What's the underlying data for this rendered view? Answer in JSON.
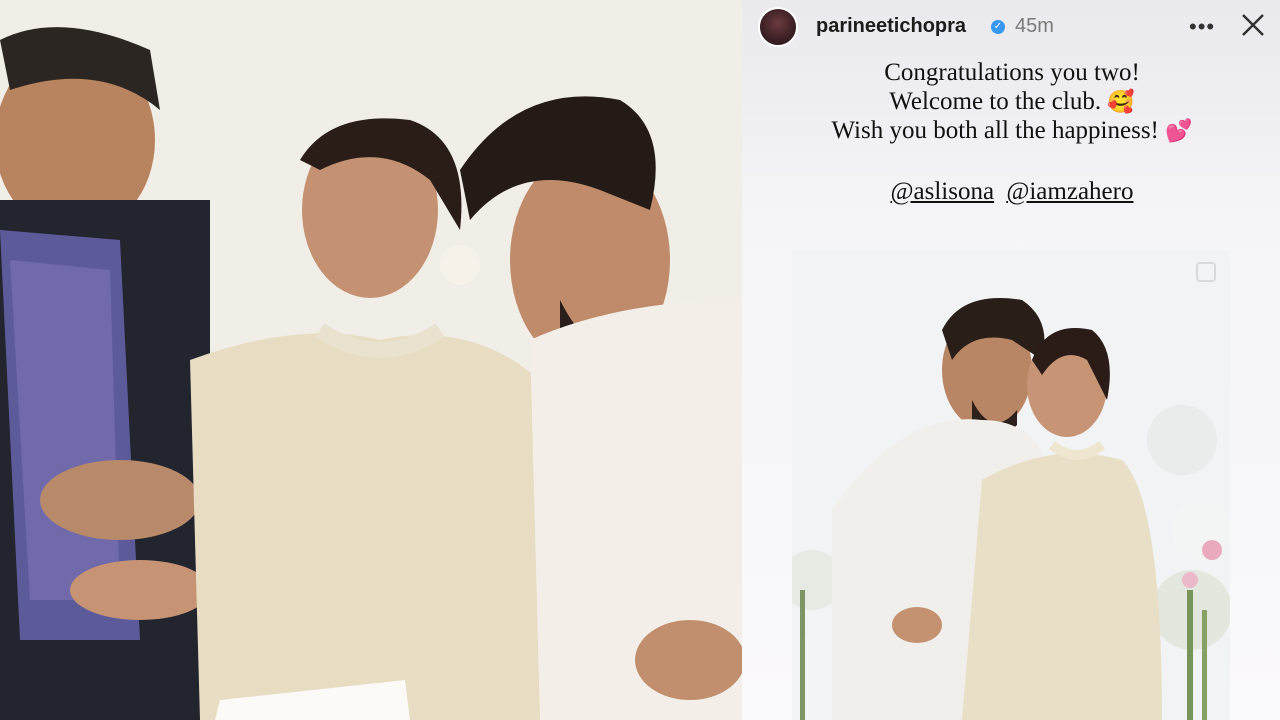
{
  "story": {
    "username": "parineetichopra",
    "time": "45m",
    "caption_lines": [
      "Congratulations you two!",
      "Welcome to the club.",
      "Wish you both all the happiness!"
    ],
    "emojis": {
      "smile": "🥰",
      "hearts": "💕"
    },
    "mentions": [
      "@aslisona",
      "@iamzahero"
    ],
    "icons": {
      "verified": "verified-badge-icon",
      "more": "more-options-icon",
      "close": "close-icon"
    }
  },
  "colors": {
    "verified": "#3897f0",
    "text": "#111111",
    "muted": "#7a7a7a"
  }
}
